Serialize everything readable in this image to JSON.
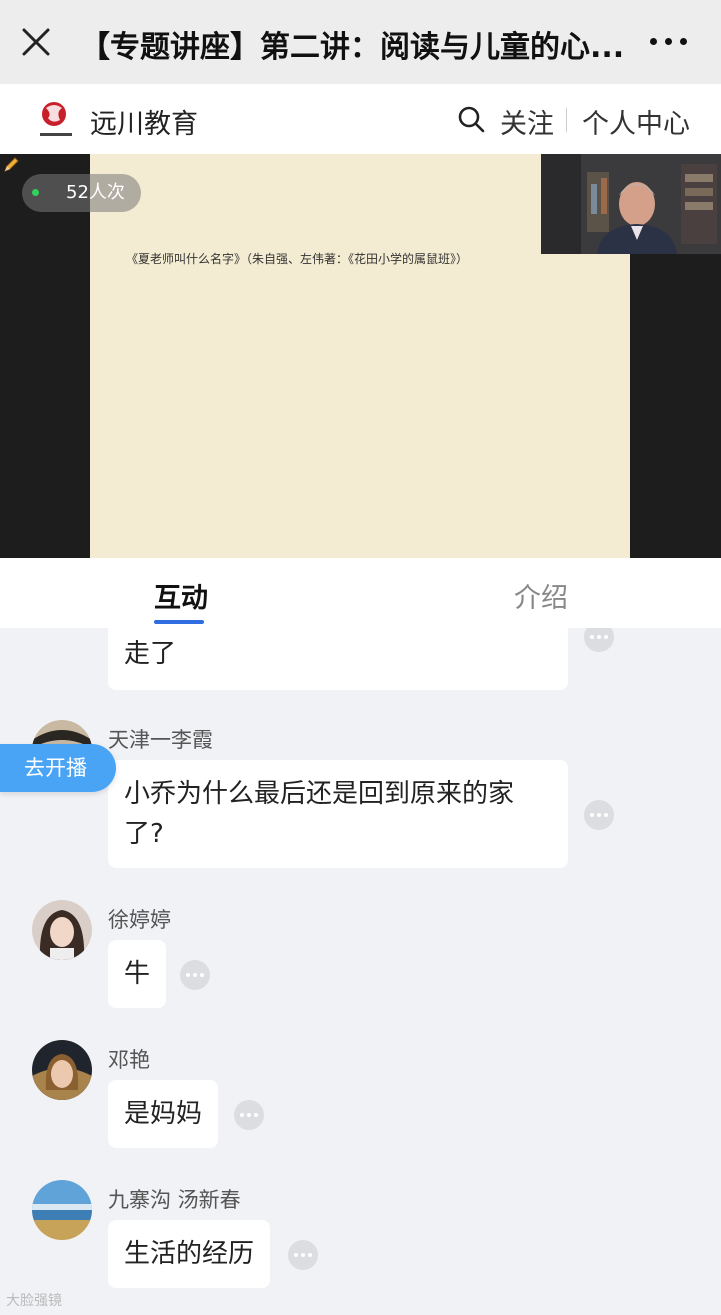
{
  "title_bar": {
    "title": "【专题讲座】第二讲：阅读与儿童的心...",
    "close_icon": "close-icon",
    "more_icon": "more-dots-icon"
  },
  "brand_bar": {
    "logo_text": "远川教育",
    "name": "远川教育",
    "follow": "关注",
    "personal_center": "个人中心"
  },
  "video": {
    "viewer_count": "52人次",
    "slide_text": "《夏老师叫什么名字》（朱自强、左伟著：《花田小学的属鼠班》）"
  },
  "tabs": [
    {
      "label": "互动",
      "active": true
    },
    {
      "label": "介绍",
      "active": false
    }
  ],
  "floating": {
    "go_live": "去开播"
  },
  "messages": [
    {
      "name": "",
      "text": "走了"
    },
    {
      "name": "天津一李霞",
      "text": "小乔为什么最后还是回到原来的家了?"
    },
    {
      "name": "徐婷婷",
      "text": "牛"
    },
    {
      "name": "邓艳",
      "text": "是妈妈"
    },
    {
      "name": "九寨沟 汤新春",
      "text": "生活的经历"
    }
  ],
  "watermark": "大脸强镜",
  "colors": {
    "accent": "#2f6de1",
    "go_live": "#4aa4f5",
    "live_dot": "#2fd35c",
    "chat_bg": "#f1f2f6"
  }
}
